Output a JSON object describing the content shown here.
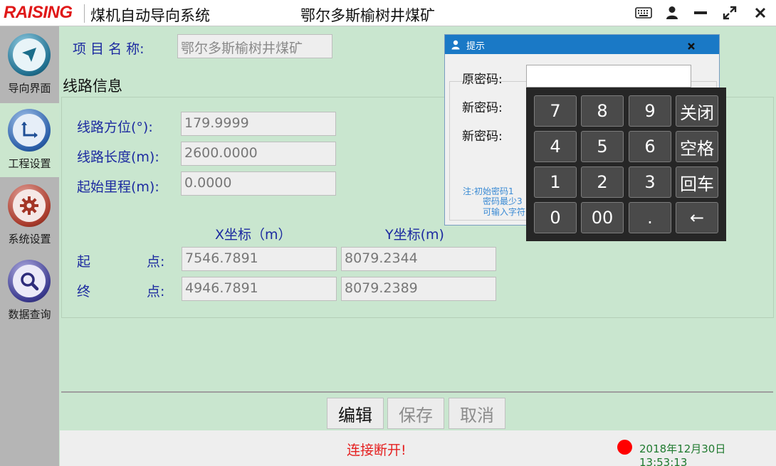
{
  "titlebar": {
    "logo": "RAISING",
    "app_title": "煤机自动导向系统",
    "mine_name": "鄂尔多斯榆树井煤矿",
    "icons": [
      "keyboard-icon",
      "user-icon",
      "minimize-icon",
      "maximize-icon",
      "close-icon"
    ]
  },
  "sidebar": {
    "items": [
      {
        "label": "导向界面",
        "icon": "navigation-arrow-icon",
        "active": false
      },
      {
        "label": "工程设置",
        "icon": "axes-icon",
        "active": true
      },
      {
        "label": "系统设置",
        "icon": "gear-icon",
        "active": false
      },
      {
        "label": "数据查询",
        "icon": "search-icon",
        "active": false
      }
    ]
  },
  "project": {
    "label": "项 目 名 称:",
    "value": "鄂尔多斯榆树井煤矿"
  },
  "route": {
    "section_title": "线路信息",
    "bearing_label": "线路方位(°):",
    "bearing_value": "179.9999",
    "length_label": "线路长度(m):",
    "length_value": "2600.0000",
    "start_mileage_label": "起始里程(m):",
    "start_mileage_value": "0.0000",
    "x_header": "X坐标（m）",
    "y_header": "Y坐标(m)",
    "start_label_a": "起",
    "start_label_b": "点:",
    "start_x": "7546.7891",
    "start_y": "8079.2344",
    "end_label_a": "终",
    "end_label_b": "点:",
    "end_x": "4946.7891",
    "end_y": "8079.2389"
  },
  "buttons": {
    "edit": "编辑",
    "save": "保存",
    "cancel": "取消"
  },
  "status": {
    "message": "连接断开!",
    "datetime": "2018年12月30日 13:53:13",
    "indicator_color": "#ff0000"
  },
  "dialog": {
    "title": "提示",
    "old_password_label": "原密码:",
    "new_password_label": "新密码:",
    "confirm_password_label": "新密码:",
    "note_line1": "注:初始密码1",
    "note_line2": "密码最少3",
    "note_line3": "可输入字符"
  },
  "keypad": {
    "keys": [
      "7",
      "8",
      "9",
      "关闭",
      "4",
      "5",
      "6",
      "空格",
      "1",
      "2",
      "3",
      "回车",
      "0",
      "00",
      ".",
      "←"
    ]
  },
  "colors": {
    "brand_red": "#e01818",
    "label_blue": "#1c2aa0",
    "background_green": "#c9e6cf",
    "dialog_title_blue": "#1a79c6"
  }
}
